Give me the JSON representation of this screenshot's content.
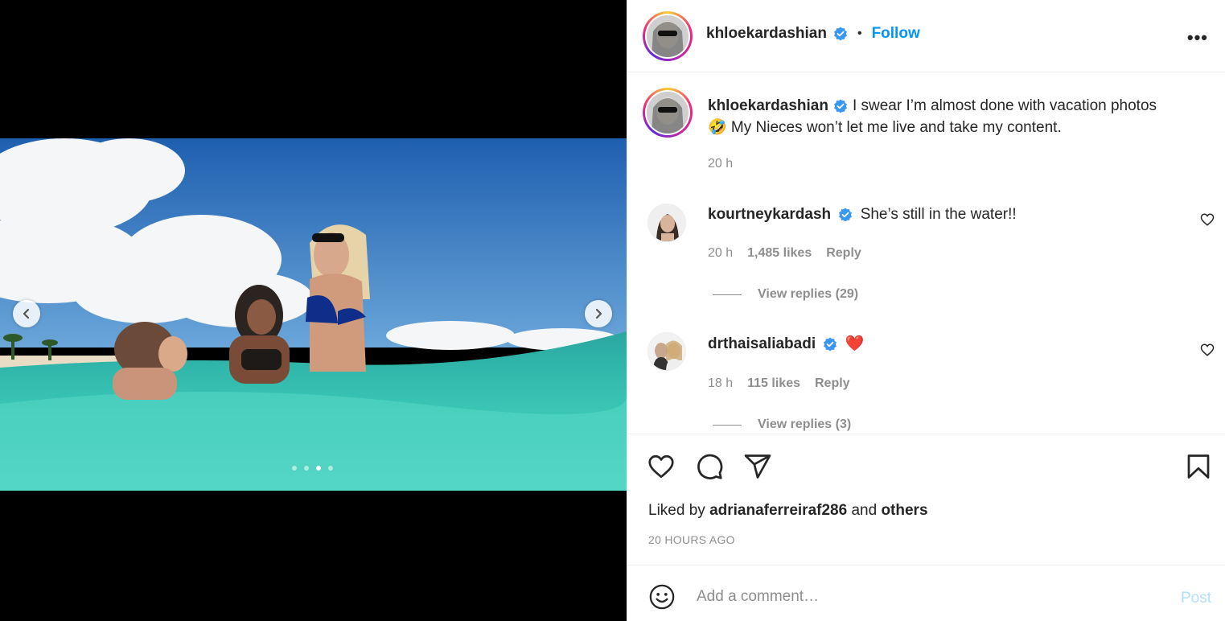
{
  "post": {
    "author": "khloekardashian",
    "follow_label": "Follow",
    "separator": "•",
    "more_label": "•••",
    "caption_line1": "I swear I’m almost done with vacation photos",
    "caption_line2": "🤣 My Nieces won’t let me live and take my content.",
    "caption_time": "20 h",
    "carousel": {
      "dots": 4,
      "active_index": 2
    }
  },
  "comments": [
    {
      "username": "kourtneykardash",
      "text": "She’s still in the water!!",
      "time": "20 h",
      "likes": "1,485 likes",
      "reply_label": "Reply",
      "view_replies": "View replies (29)"
    },
    {
      "username": "drthaisaliabadi",
      "text": "❤️",
      "time": "18 h",
      "likes": "115 likes",
      "reply_label": "Reply",
      "view_replies": "View replies (3)"
    }
  ],
  "likes_summary": {
    "prefix": "Liked by",
    "user": "adrianaferreiraf286",
    "joiner": "and",
    "others": "others"
  },
  "posted_ago": "20 HOURS AGO",
  "comment_box": {
    "placeholder": "Add a comment…",
    "post_label": "Post"
  },
  "colors": {
    "accent": "#0095f6",
    "post_disabled": "#b2dffc",
    "muted": "#8e8e8e"
  },
  "icons": [
    "chevron-left-icon",
    "chevron-right-icon",
    "verified-icon",
    "more-icon",
    "heart-icon",
    "comment-icon",
    "share-icon",
    "bookmark-icon",
    "emoji-icon"
  ]
}
